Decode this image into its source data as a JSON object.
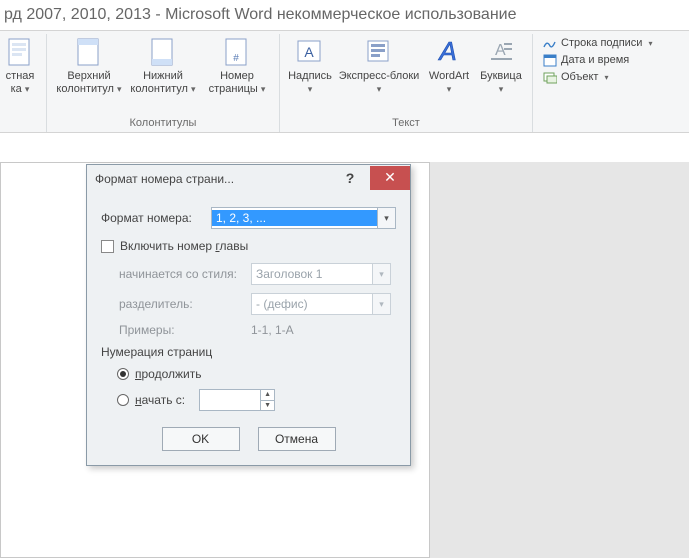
{
  "window_title": "рд 2007, 2010, 2013  -  Microsoft Word некоммерческое использование",
  "ribbon": {
    "groups": {
      "truncated": {
        "btn_label_l1": "стная",
        "btn_label_l2": "ка"
      },
      "colontitles": {
        "caption": "Колонтитулы",
        "header_top_l1": "Верхний",
        "header_top_l2": "колонтитул",
        "header_bottom_l1": "Нижний",
        "header_bottom_l2": "колонтитул",
        "page_number_l1": "Номер",
        "page_number_l2": "страницы"
      },
      "text": {
        "caption": "Текст",
        "textbox": "Надпись",
        "quickparts": "Экспресс-блоки",
        "wordart": "WordArt",
        "dropcap": "Буквица"
      },
      "side": {
        "signature": "Строка подписи",
        "datetime": "Дата и время",
        "object": "Объект"
      }
    }
  },
  "dialog": {
    "title": "Формат номера страни...",
    "format_label": "Формат номера:",
    "format_value": "1, 2, 3, ...",
    "include_chapter": "Включить номер главы",
    "include_hotkey_char": "г",
    "style_label": "начинается со стиля:",
    "style_value": "Заголовок 1",
    "separator_label": "разделитель:",
    "separator_value": "-   (дефис)",
    "examples_label": "Примеры:",
    "examples_value": "1-1, 1-A",
    "numbering_title": "Нумерация страниц",
    "continue_label": "продолжить",
    "continue_hotkey_char": "п",
    "startat_label": "начать с:",
    "startat_hotkey_char": "н",
    "startat_value": "",
    "ok": "OK",
    "cancel": "Отмена"
  }
}
